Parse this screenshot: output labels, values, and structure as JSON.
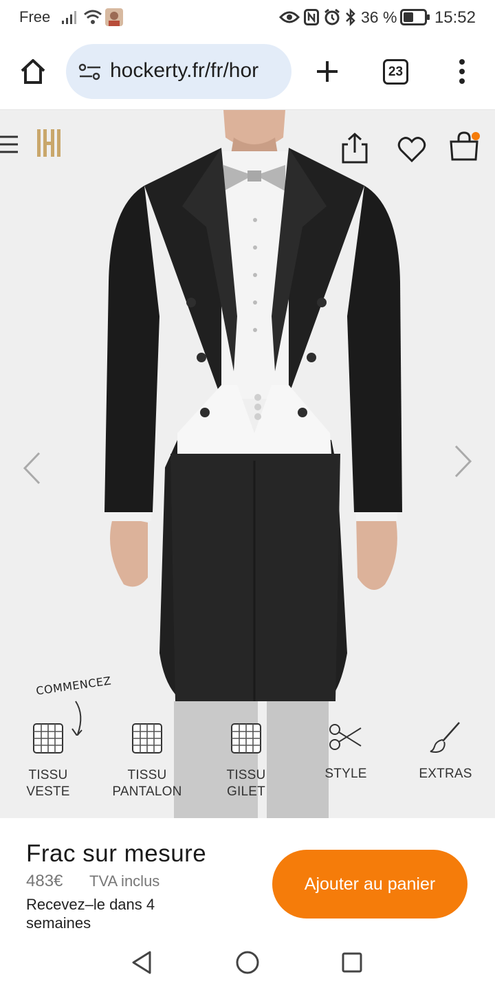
{
  "status_bar": {
    "carrier": "Free",
    "battery": "36 %",
    "time": "15:52",
    "icons": [
      "signal-icon",
      "wifi-icon",
      "avatar-icon",
      "eye-icon",
      "nfc-icon",
      "alarm-icon",
      "bluetooth-icon",
      "battery-icon"
    ]
  },
  "browser": {
    "url": "hockerty.fr/fr/hor",
    "tab_count": "23"
  },
  "product_options": [
    {
      "line1": "TISSU",
      "line2": "VESTE",
      "icon": "fabric-swatch-icon"
    },
    {
      "line1": "TISSU",
      "line2": "PANTALON",
      "icon": "fabric-swatch-icon"
    },
    {
      "line1": "TISSU",
      "line2": "GILET",
      "icon": "fabric-swatch-icon"
    },
    {
      "line1": "STYLE",
      "line2": "",
      "icon": "scissors-icon"
    },
    {
      "line1": "EXTRAS",
      "line2": "",
      "icon": "brush-icon"
    }
  ],
  "start_hint": "COMMENCEZ",
  "product": {
    "title": "Frac sur mesure",
    "price": "483€",
    "tax_note": "TVA inclus",
    "delivery": "Recevez–le dans 4 semaines",
    "cta": "Ajouter au panier"
  },
  "colors": {
    "accent": "#f57c0a",
    "brand_gold": "#c9a76b",
    "url_pill": "#e3ecf8"
  }
}
